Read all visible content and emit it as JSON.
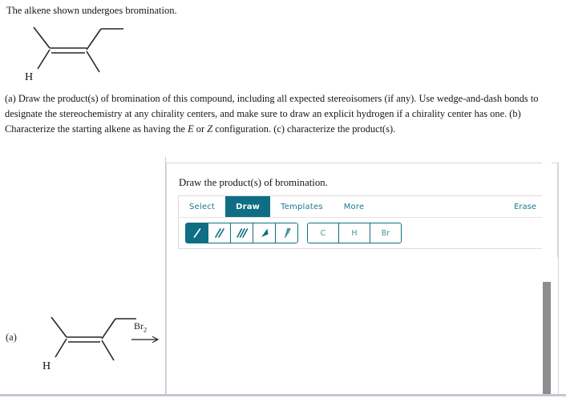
{
  "header": {
    "intro": "The alkene shown undergoes bromination."
  },
  "question": {
    "part_a": "(a) Draw the product(s) of bromination of this compound, including all expected stereoisomers (if any). Use wedge-and-dash bonds to designate the stereochemistry at any chirality centers, and make sure to draw an explicit hydrogen if a chirality center has one.",
    "part_b_pre": "(b) Characterize the starting alkene as having the ",
    "part_b_e": "E",
    "part_b_or": " or ",
    "part_b_z": "Z",
    "part_b_post": " configuration.",
    "part_c": "(c) characterize the product(s)."
  },
  "editor": {
    "title": "Draw the product(s) of bromination.",
    "tabs": [
      {
        "label": "Select",
        "active": false
      },
      {
        "label": "Draw",
        "active": true
      },
      {
        "label": "Templates",
        "active": false
      },
      {
        "label": "More",
        "active": false
      }
    ],
    "erase_label": "Erase",
    "bond_tools": [
      {
        "name": "single-bond-tool",
        "icon": "single-line",
        "active": true
      },
      {
        "name": "double-bond-tool",
        "icon": "double-line",
        "active": false
      },
      {
        "name": "triple-bond-tool",
        "icon": "triple-line",
        "active": false
      },
      {
        "name": "wedge-bond-tool",
        "icon": "solid-wedge",
        "active": false
      },
      {
        "name": "dash-bond-tool",
        "icon": "hashed-wedge",
        "active": false
      }
    ],
    "atom_tools": [
      {
        "label": "C",
        "name": "carbon-atom-tool"
      },
      {
        "label": "H",
        "name": "hydrogen-atom-tool"
      },
      {
        "label": "Br",
        "name": "bromine-atom-tool"
      }
    ]
  },
  "reaction": {
    "row_label": "(a)",
    "reagent": "Br",
    "reagent_sub": "2",
    "structure_h_label": "H"
  },
  "molecule": {
    "h_label": "H"
  },
  "colors": {
    "teal": "#0f6e83",
    "teal_text": "#17798e",
    "atom_text": "#4d8fa0",
    "border": "#dcdce1",
    "scrollbar": "#8d8d8d"
  }
}
